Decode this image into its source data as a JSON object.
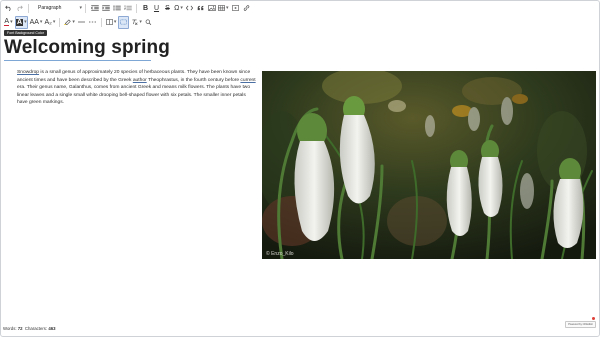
{
  "toolbar": {
    "undo_icon": "undo-icon",
    "redo_icon": "redo-icon",
    "paragraph_value": "Paragraph",
    "text_color_letter": "A",
    "bg_color_letter": "A",
    "font_size_glyph": "AA",
    "font_family_glyph": "A₂",
    "bold_letter": "B",
    "underline_letter": "U",
    "strike_letter": "S",
    "omega_glyph": "Ω",
    "accent_color": "#3c6fb8"
  },
  "tooltip": "Font Background Color",
  "document": {
    "title": "Welcoming spring",
    "paragraph": [
      {
        "text": "Snowdrop",
        "link": true
      },
      {
        "text": " is a small genus of approximately 20 species of herbaceous plants. They have been known since ancient times and have been described by the Greek ",
        "link": false
      },
      {
        "text": "author",
        "link": true
      },
      {
        "text": " Theophrastus, in the fourth century before ",
        "link": false
      },
      {
        "text": "current",
        "link": true
      },
      {
        "text": " era. Their genus name, Galanthus, comes from ancient Greek and means milk flowers. The plants have two linear leaves and a single small white drooping bell-shaped flower with six petals. The smaller inner petals have green markings.",
        "link": false
      }
    ],
    "image_watermark": "© Enzo_Kilo"
  },
  "status": {
    "words_label": "Words:",
    "words_value": "72",
    "chars_label": "Characters:",
    "chars_value": "463"
  },
  "brand": "Powered by CKEditor"
}
